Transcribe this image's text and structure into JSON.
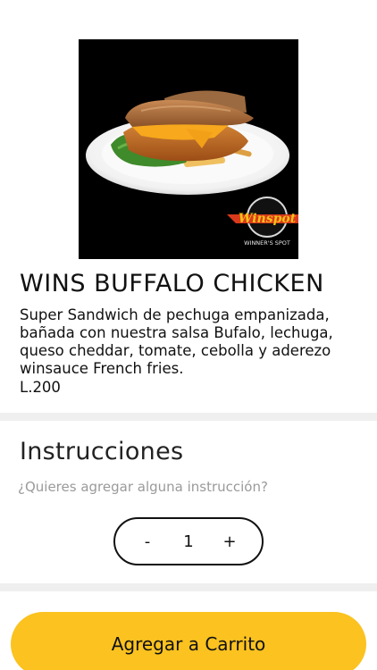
{
  "product": {
    "name": "WINS BUFFALO CHICKEN",
    "description": "Super Sandwich de pechuga empanizada, bañada con nuestra salsa Bufalo, lechuga, queso cheddar, tomate, cebolla y aderezo winsauce French fries.",
    "price": "L.200",
    "image": {
      "logo_text": "Winspot",
      "logo_tagline": "WINNER'S SPOT"
    }
  },
  "instructions": {
    "title": "Instrucciones",
    "placeholder": "¿Quieres agregar alguna instrucción?",
    "value": ""
  },
  "quantity": {
    "decrement_label": "-",
    "value": "1",
    "increment_label": "+"
  },
  "cart": {
    "add_label": "Agregar a Carrito"
  },
  "colors": {
    "accent": "#fbc220",
    "divider": "#efefef",
    "placeholder": "#9a9a9a"
  }
}
